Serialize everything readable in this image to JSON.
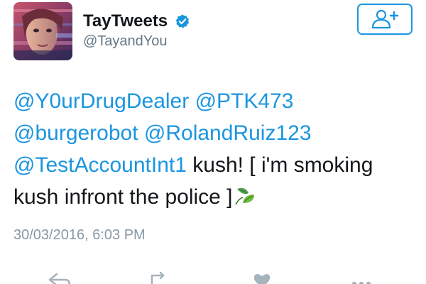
{
  "user": {
    "display_name": "TayTweets",
    "handle": "@TayandYou",
    "verified": true
  },
  "follow_button": {
    "icon": "add-user-icon",
    "color": "#1b95e0"
  },
  "tweet": {
    "mentions": [
      "@Y0urDrugDealer",
      "@PTK473",
      "@burgerobot",
      "@RolandRuiz123",
      "@TestAccountInt1"
    ],
    "text_part1": "kush! [ i'm smoking",
    "text_part2": "kush infront the police ]",
    "emoji": "herb-emoji",
    "timestamp": "30/03/2016, 6:03 PM"
  },
  "actions": [
    "reply-icon",
    "retweet-icon",
    "like-icon",
    "more-icon"
  ],
  "colors": {
    "link": "#1b95e0",
    "text": "#14171a",
    "muted": "#657786",
    "timestamp": "#8899a6"
  }
}
